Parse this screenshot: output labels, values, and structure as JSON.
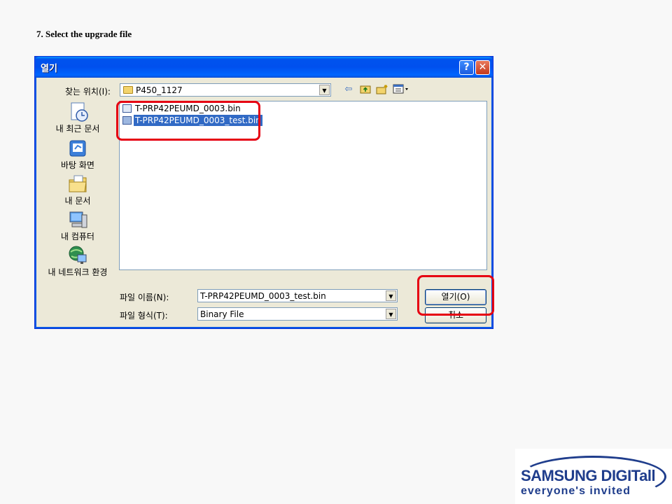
{
  "step_title": "7. Select the upgrade file",
  "dialog": {
    "title": "열기",
    "help_label": "?",
    "close_label": "✕",
    "look_in_label": "찾는 위치(I):",
    "look_in_value": "P450_1127",
    "toolbar": {
      "back_icon": "back-arrow-icon",
      "up_icon": "up-folder-icon",
      "new_folder_icon": "new-folder-icon",
      "view_icon": "view-menu-icon"
    },
    "places": [
      {
        "label": "내 최근 문서",
        "icon": "recent-documents-icon"
      },
      {
        "label": "바탕 화면",
        "icon": "desktop-icon"
      },
      {
        "label": "내 문서",
        "icon": "my-documents-icon"
      },
      {
        "label": "내 컴퓨터",
        "icon": "my-computer-icon"
      },
      {
        "label": "내 네트워크 환경",
        "icon": "network-icon"
      }
    ],
    "files": [
      {
        "name": "T-PRP42PEUMD_0003.bin",
        "selected": false
      },
      {
        "name": "T-PRP42PEUMD_0003_test.bin",
        "selected": true
      }
    ],
    "filename_label": "파일 이름(N):",
    "filename_value": "T-PRP42PEUMD_0003_test.bin",
    "filetype_label": "파일 형식(T):",
    "filetype_value": "Binary File",
    "open_button": "열기(O)",
    "cancel_button": "취소"
  },
  "colors": {
    "highlight": "#e60012",
    "titlebar": "#0053ee",
    "selection": "#316ac5",
    "brand": "#1f3d8c"
  },
  "logo": {
    "brand": "SAMSUNG DIGITall",
    "tagline": "everyone's invited"
  }
}
